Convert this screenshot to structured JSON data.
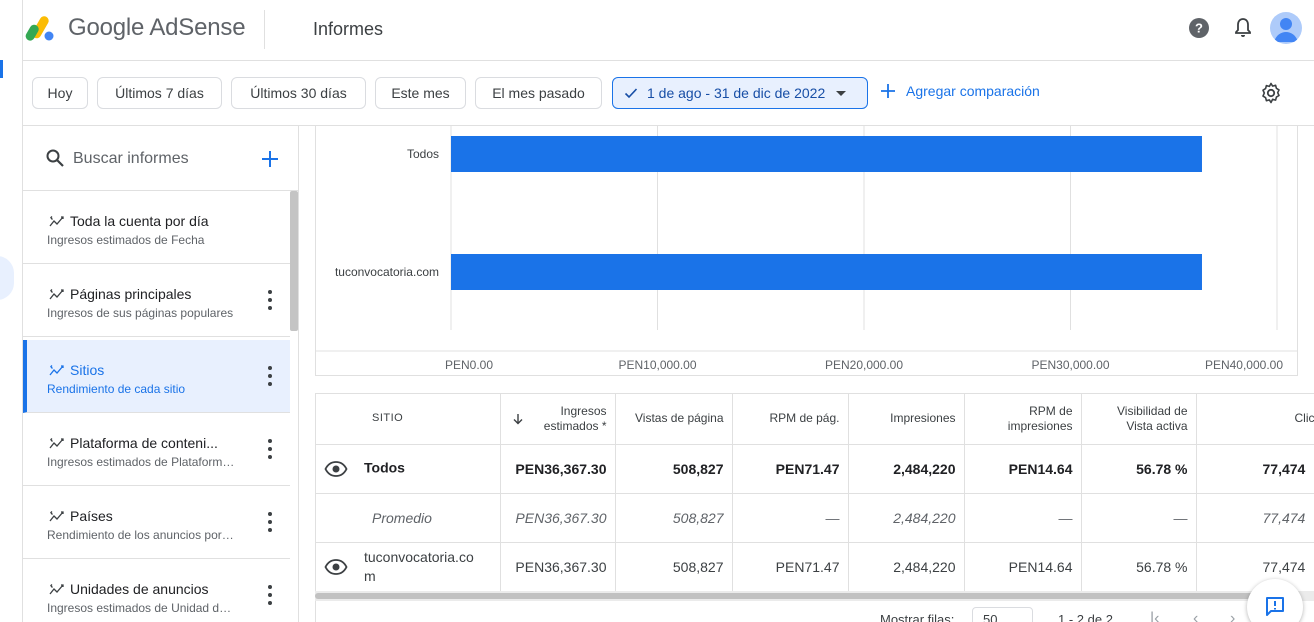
{
  "app": {
    "brand": "Google AdSense",
    "page_title": "Informes"
  },
  "header_icons": [
    "help-icon",
    "bell-icon",
    "avatar"
  ],
  "toolbar": {
    "chips": [
      "Hoy",
      "Últimos 7 días",
      "Últimos 30 días",
      "Este mes",
      "El mes pasado"
    ],
    "date_range": "1 de ago - 31 de dic de 2022",
    "add_comparison": "Agregar comparación"
  },
  "sidebar": {
    "search_placeholder": "Buscar informes",
    "reports": [
      {
        "title": "Toda la cuenta por día",
        "subtitle": "Ingresos estimados de Fecha",
        "has_menu": false,
        "selected": false
      },
      {
        "title": "Páginas principales",
        "subtitle": "Ingresos de sus páginas populares",
        "has_menu": true,
        "selected": false
      },
      {
        "title": "Sitios",
        "subtitle": "Rendimiento de cada sitio",
        "has_menu": true,
        "selected": true
      },
      {
        "title": "Plataforma de conteni...",
        "subtitle": "Ingresos estimados de Plataforma de contenido",
        "has_menu": true,
        "selected": false
      },
      {
        "title": "Países",
        "subtitle": "Rendimiento de los anuncios por país",
        "has_menu": true,
        "selected": false
      },
      {
        "title": "Unidades de anuncios",
        "subtitle": "Ingresos estimados de Unidad de anuncios",
        "has_menu": true,
        "selected": false
      }
    ]
  },
  "chart_data": {
    "type": "bar",
    "orientation": "horizontal",
    "categories": [
      "Todos",
      "tuconvocatoria.com"
    ],
    "values": [
      36367.3,
      36367.3
    ],
    "xlim": [
      0,
      40000
    ],
    "x_ticks": [
      "PEN0.00",
      "PEN10,000.00",
      "PEN20,000.00",
      "PEN30,000.00",
      "PEN40,000.00"
    ],
    "grid": true,
    "color": "#1a73e8"
  },
  "table": {
    "headers": [
      "SITIO",
      "Ingresos estimados *",
      "Vistas de página",
      "RPM de pág.",
      "Impresiones",
      "RPM de impresiones",
      "Visibilidad de Vista activa",
      "Clics"
    ],
    "sorted_column": "Ingresos estimados *",
    "rows": [
      {
        "type": "total",
        "has_eye": true,
        "cells": [
          "Todos",
          "PEN36,367.30",
          "508,827",
          "PEN71.47",
          "2,484,220",
          "PEN14.64",
          "56.78 %",
          "77,474"
        ]
      },
      {
        "type": "avg",
        "has_eye": false,
        "cells": [
          "Promedio",
          "PEN36,367.30",
          "508,827",
          "—",
          "2,484,220",
          "—",
          "—",
          "77,474"
        ]
      },
      {
        "type": "row",
        "has_eye": true,
        "cells": [
          "tuconvocatoria.com",
          "PEN36,367.30",
          "508,827",
          "PEN71.47",
          "2,484,220",
          "PEN14.64",
          "56.78 %",
          "77,474"
        ]
      }
    ]
  },
  "pager": {
    "rows_label": "Mostrar filas:",
    "rows_value": "50",
    "range": "1 - 2 de 2"
  },
  "colors": {
    "accent": "#1a73e8",
    "selected_bg": "#e8f0fe"
  }
}
